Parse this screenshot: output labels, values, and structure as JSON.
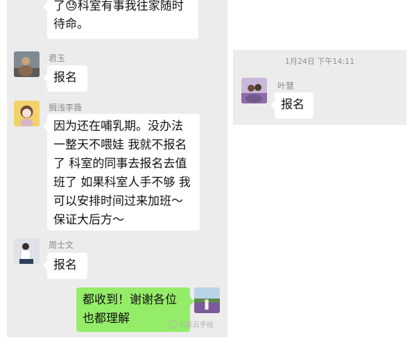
{
  "left_panel": {
    "top_message": {
      "line1": "了😓科室有事我往家随时",
      "line2": "待命。"
    },
    "messages": [
      {
        "sender": "君玉",
        "text": "报名"
      },
      {
        "sender": "搁浅李薇",
        "lines": [
          "因为还在哺乳期。没办法",
          "一整天不喂娃 我就不报名",
          "了 科室的同事去报名去值",
          "班了 如果科室人手不够 我",
          "可以安排时间过来加班～",
          "保证大后方～"
        ]
      },
      {
        "sender": "周士文",
        "text": "报名"
      }
    ],
    "own_message": {
      "lines": [
        "都收到！谢谢各位",
        "也都理解"
      ]
    },
    "watermark": "七彩云手绘"
  },
  "right_panel": {
    "timestamp": "1月24日 下午14:11",
    "message": {
      "sender": "叶慧",
      "text": "报名"
    }
  }
}
